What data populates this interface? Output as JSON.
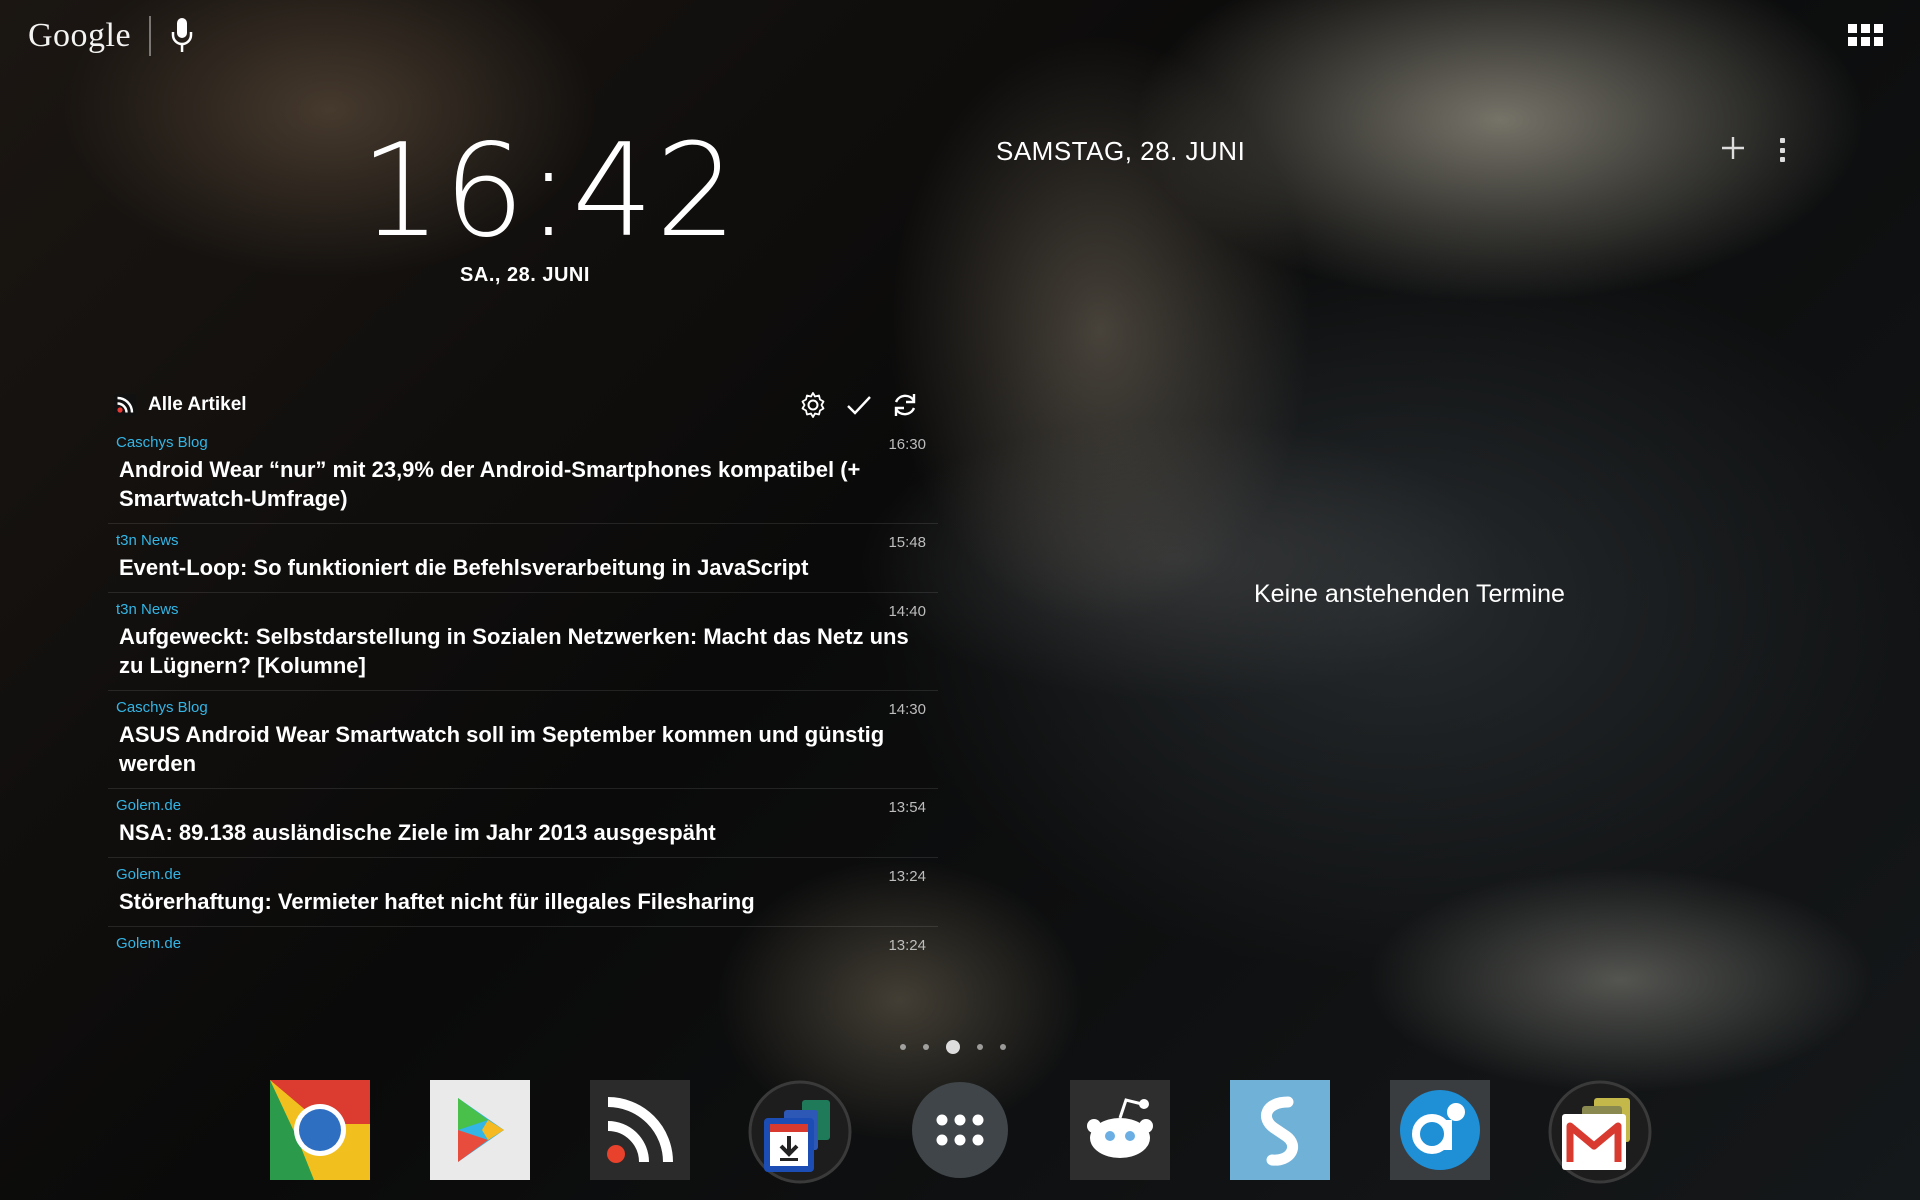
{
  "search": {
    "logo": "Google"
  },
  "clock": {
    "time": "16:42",
    "date": "SA., 28. JUNI"
  },
  "news": {
    "title": "Alle Artikel",
    "items": [
      {
        "source": "Caschys Blog",
        "time": "16:30",
        "headline": "Android Wear “nur” mit 23,9% der Android-Smartphones kompatibel (+ Smartwatch-Umfrage)"
      },
      {
        "source": "t3n News",
        "time": "15:48",
        "headline": "Event-Loop: So funktioniert die Befehlsverarbeitung in JavaScript"
      },
      {
        "source": "t3n News",
        "time": "14:40",
        "headline": "Aufgeweckt: Selbstdarstellung in Sozialen Netzwerken: Macht das Netz uns zu Lügnern? [Kolumne]"
      },
      {
        "source": "Caschys Blog",
        "time": "14:30",
        "headline": "ASUS Android Wear Smartwatch soll im September kommen und günstig werden"
      },
      {
        "source": "Golem.de",
        "time": "13:54",
        "headline": "NSA: 89.138 ausländische Ziele im Jahr 2013 ausgespäht"
      },
      {
        "source": "Golem.de",
        "time": "13:24",
        "headline": "Störerhaftung: Vermieter haftet nicht für illegales Filesharing"
      },
      {
        "source": "Golem.de",
        "time": "13:24",
        "headline": ""
      }
    ]
  },
  "calendar": {
    "date": "SAMSTAG, 28. JUNI",
    "empty_message": "Keine anstehenden Termine"
  },
  "pager": {
    "pages": 5,
    "active_page": 3
  },
  "dock": {
    "apps": [
      {
        "icon": "chrome-icon"
      },
      {
        "icon": "play-store-icon"
      },
      {
        "icon": "rss-reader-icon"
      },
      {
        "icon": "downloads-folder-icon"
      },
      {
        "icon": "app-drawer-icon"
      },
      {
        "icon": "reddit-icon"
      },
      {
        "icon": "shazam-icon"
      },
      {
        "icon": "airdroid-icon"
      },
      {
        "icon": "gmail-folder-icon"
      }
    ]
  },
  "colors": {
    "accent": "#33b5e5"
  }
}
